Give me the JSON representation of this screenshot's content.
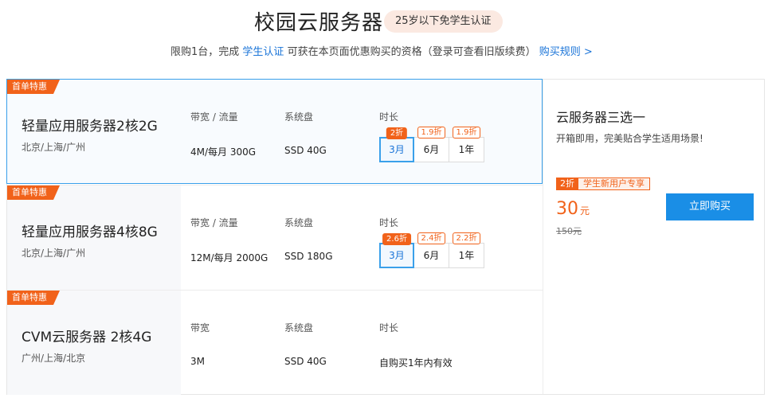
{
  "header": {
    "title": "校园云服务器",
    "age_badge": "25岁以下免学生认证",
    "sub_prefix": "限购1台，完成",
    "sub_highlight": "学生认证",
    "sub_middle": "可获在本页面优惠购买的资格（登录可查看旧版续费）",
    "sub_link": "购买规则 >"
  },
  "labels": {
    "tag": "首单特惠",
    "bandwidth_traffic": "带宽 / 流量",
    "bandwidth": "带宽",
    "disk": "系统盘",
    "duration": "时长"
  },
  "products": [
    {
      "name": "轻量应用服务器2核2G",
      "regions": "北京/上海/广州",
      "bandwidth": "4M/每月 300G",
      "disk": "SSD 40G",
      "durations": [
        {
          "label": "3月",
          "discount": "2折",
          "selected": true
        },
        {
          "label": "6月",
          "discount": "1.9折",
          "selected": false
        },
        {
          "label": "1年",
          "discount": "1.9折",
          "selected": false
        }
      ]
    },
    {
      "name": "轻量应用服务器4核8G",
      "regions": "北京/上海/广州",
      "bandwidth": "12M/每月 2000G",
      "disk": "SSD 180G",
      "durations": [
        {
          "label": "3月",
          "discount": "2.6折",
          "selected": true
        },
        {
          "label": "6月",
          "discount": "2.4折",
          "selected": false
        },
        {
          "label": "1年",
          "discount": "2.2折",
          "selected": false
        }
      ]
    },
    {
      "name": "CVM云服务器 2核4G",
      "regions": "广州/上海/北京",
      "bandwidth": "3M",
      "disk": "SSD 40G",
      "duration_text": "自购买1年内有效"
    }
  ],
  "side": {
    "title": "云服务器三选一",
    "desc": "开箱即用，完美贴合学生适用场景!",
    "badge_discount": "2折",
    "badge_text": "学生新用户专享",
    "price": "30",
    "price_unit": "元",
    "original_price": "150元",
    "buy_label": "立即购买"
  },
  "colors": {
    "accent_blue": "#1a8ee6",
    "accent_orange": "#f1621a"
  }
}
